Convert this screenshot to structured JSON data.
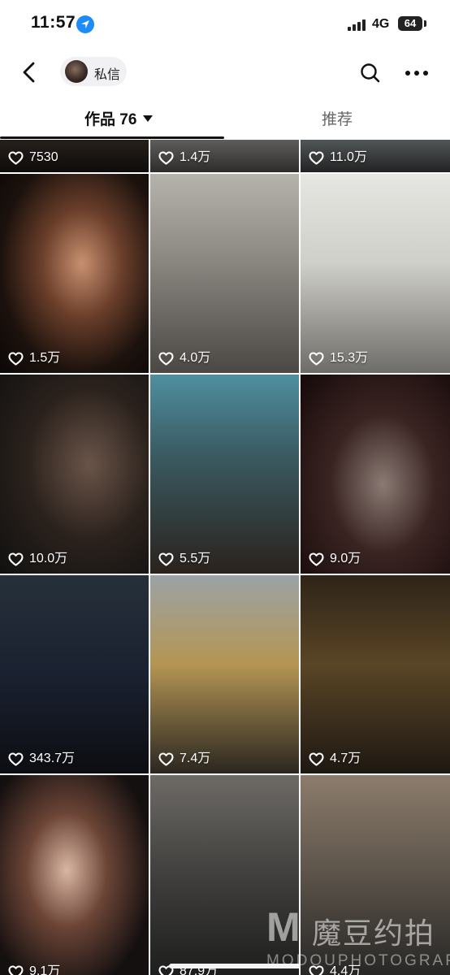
{
  "status_bar": {
    "time": "11:57",
    "network": "4G",
    "battery": "64"
  },
  "header": {
    "message_chip_label": "私信"
  },
  "tabs": [
    {
      "label": "作品 76"
    },
    {
      "label": "推荐"
    }
  ],
  "grid": {
    "items": [
      {
        "likes": "7530"
      },
      {
        "likes": "1.4万"
      },
      {
        "likes": "11.0万"
      },
      {
        "likes": "1.5万"
      },
      {
        "likes": "4.0万"
      },
      {
        "likes": "15.3万"
      },
      {
        "likes": "10.0万"
      },
      {
        "likes": "5.5万"
      },
      {
        "likes": "9.0万"
      },
      {
        "likes": "343.7万"
      },
      {
        "likes": "7.4万"
      },
      {
        "likes": "4.7万"
      },
      {
        "likes": "9.1万"
      },
      {
        "likes": "87.9万"
      },
      {
        "likes": "4.4万"
      }
    ]
  },
  "watermark": {
    "logo_letter": "M",
    "text_cn": "魔豆约拍",
    "text_en": "MODOUPHOTOGRAPH"
  }
}
